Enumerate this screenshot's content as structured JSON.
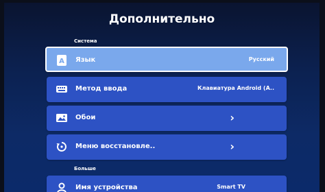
{
  "header": {
    "title": "Дополнительно"
  },
  "sections": {
    "system": "Система",
    "more": "Больше"
  },
  "rows": [
    {
      "label": "Язык",
      "value": "Русский",
      "icon": "language-icon"
    },
    {
      "label": "Метод ввода",
      "value": "Клавиатура Android (A..",
      "icon": "keyboard-icon"
    },
    {
      "label": "Обои",
      "value": "",
      "icon": "image-icon"
    },
    {
      "label": "Меню восстановле..",
      "value": "",
      "icon": "restore-icon"
    },
    {
      "label": "Имя устройства",
      "value": "Smart TV",
      "icon": "person-icon"
    }
  ],
  "colors": {
    "accent": "#2d52c4",
    "selected": "#7aa8ec"
  }
}
